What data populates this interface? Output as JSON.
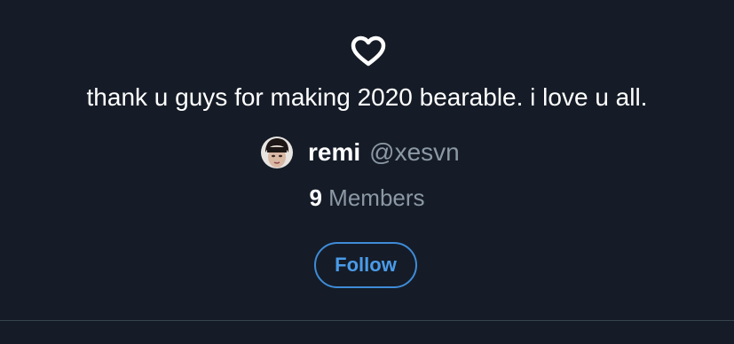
{
  "list": {
    "icon": "heart-outline-icon",
    "description": "thank u guys for making 2020 bearable. i love u all.",
    "owner": {
      "name": "remi",
      "handle": "@xesvn"
    },
    "members": {
      "count": "9",
      "label": "Members"
    },
    "follow_label": "Follow"
  },
  "colors": {
    "background": "#151c27",
    "text_primary": "#ffffff",
    "text_secondary": "#8b98a5",
    "accent": "#4a9be9",
    "divider": "#38444d"
  }
}
